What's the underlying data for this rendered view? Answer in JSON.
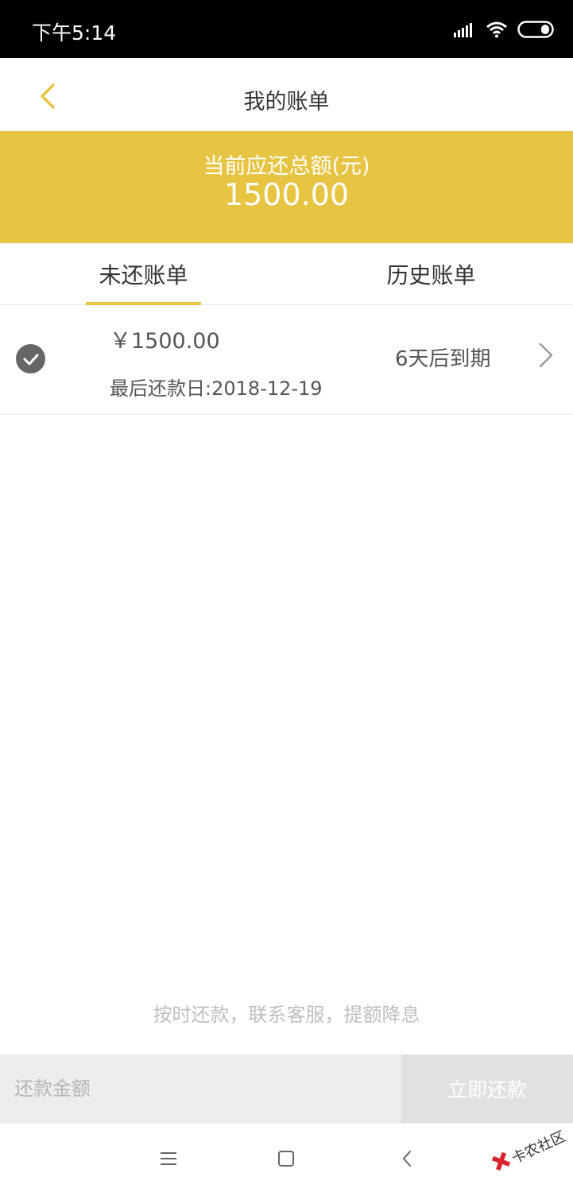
{
  "status_bar": {
    "time": "下午5:14"
  },
  "nav": {
    "title": "我的账单"
  },
  "summary": {
    "label": "当前应还总额(元)",
    "amount": "1500.00"
  },
  "tabs": [
    {
      "label": "未还账单",
      "active": true
    },
    {
      "label": "历史账单",
      "active": false
    }
  ],
  "bill": {
    "amount": "￥1500.00",
    "due_date": "最后还款日:2018-12-19",
    "status": "6天后到期"
  },
  "hint": "按时还款，联系客服，提额降息",
  "pay_bar": {
    "placeholder": "还款金额",
    "button_label": "立即还款"
  },
  "watermark": "卡农社区",
  "colors": {
    "accent": "#e8c443",
    "button_disabled": "#e1e1e1",
    "status_bar": "#000000"
  },
  "icons": [
    "back-arrow-icon",
    "check-circle-icon",
    "chevron-right-icon",
    "signal-icon",
    "wifi-icon",
    "battery-icon",
    "menu-icon",
    "home-icon",
    "system-back-icon"
  ]
}
